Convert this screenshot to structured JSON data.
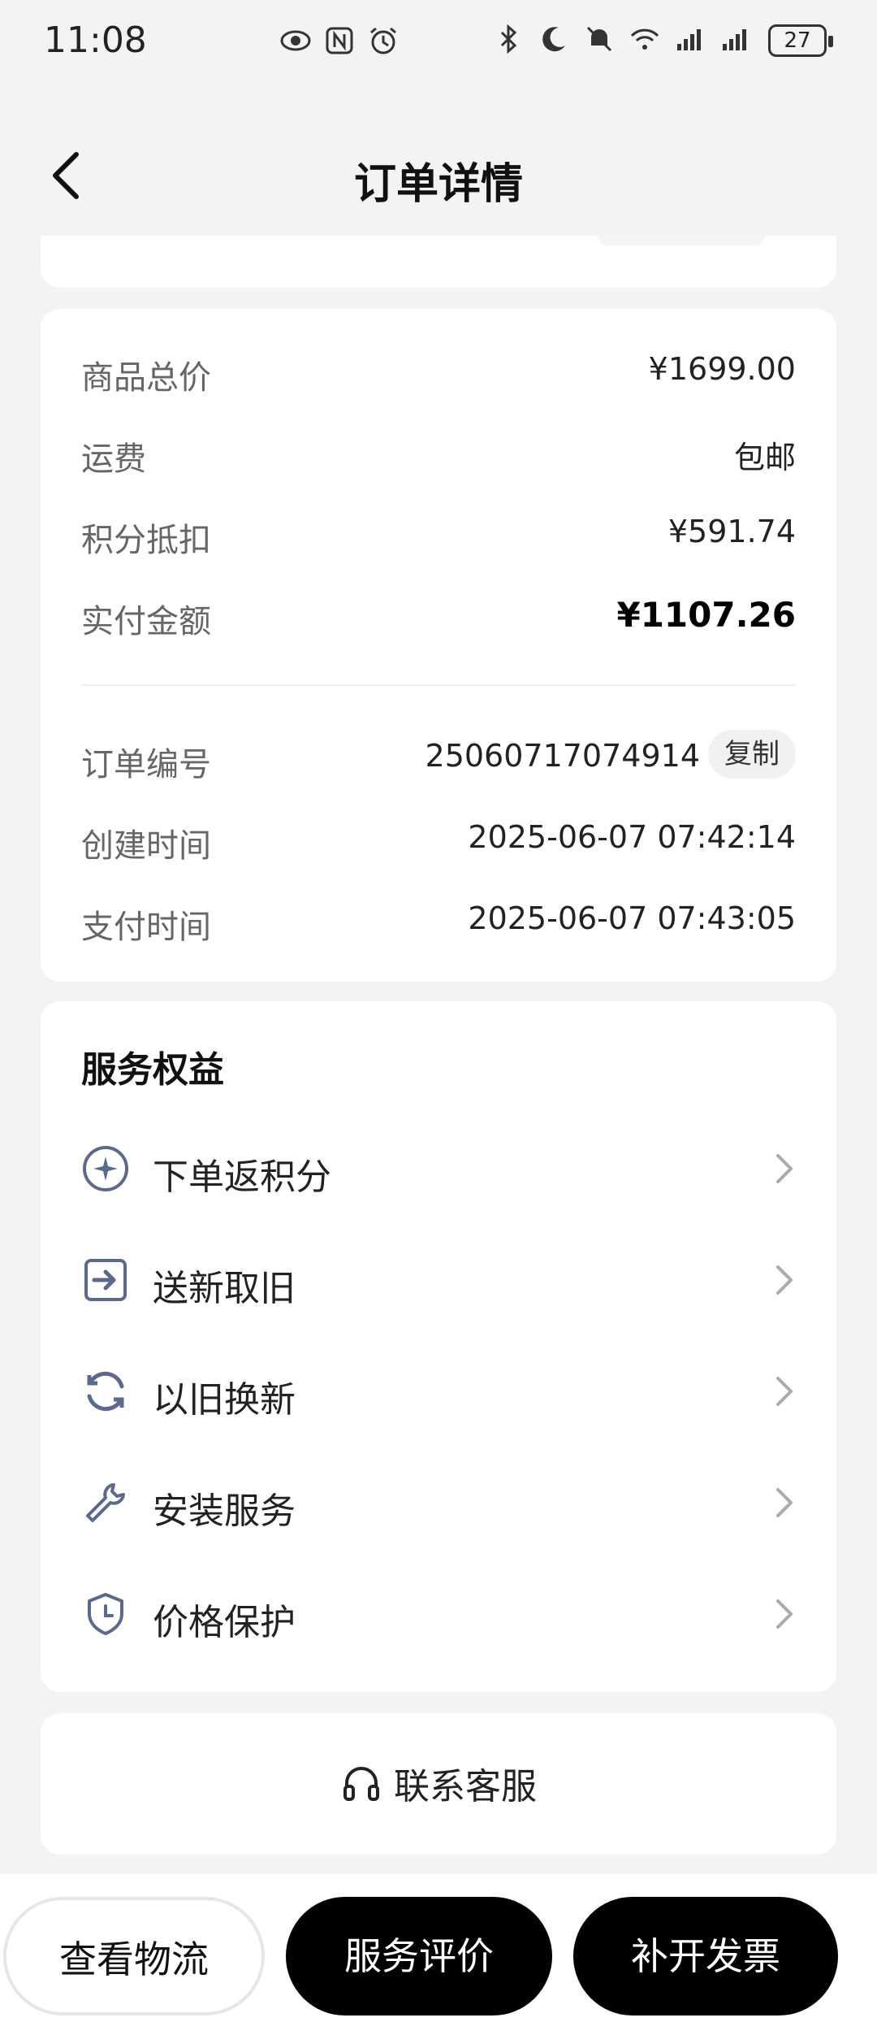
{
  "status_bar": {
    "time": "11:08",
    "battery": "27",
    "icons": [
      "eye-icon",
      "nfc-icon",
      "alarm-icon",
      "bluetooth-icon",
      "moon-icon",
      "mute-icon",
      "wifi-icon",
      "signal-icon",
      "signal-icon"
    ]
  },
  "header": {
    "title": "订单详情"
  },
  "price": {
    "rows": [
      {
        "label": "商品总价",
        "value": "¥1699.00"
      },
      {
        "label": "运费",
        "value": "包邮"
      },
      {
        "label": "积分抵扣",
        "value": "¥591.74"
      },
      {
        "label": "实付金额",
        "value": "¥1107.26"
      }
    ],
    "order": {
      "number_label": "订单编号",
      "number": "25060717074914",
      "copy_label": "复制",
      "created_label": "创建时间",
      "created": "2025-06-07 07:42:14",
      "paid_label": "支付时间",
      "paid": "2025-06-07 07:43:05"
    }
  },
  "service": {
    "title": "服务权益",
    "items": [
      {
        "label": "下单返积分",
        "icon": "star-circle-icon"
      },
      {
        "label": "送新取旧",
        "icon": "arrow-box-icon"
      },
      {
        "label": "以旧换新",
        "icon": "refresh-icon"
      },
      {
        "label": "安装服务",
        "icon": "wrench-icon"
      },
      {
        "label": "价格保护",
        "icon": "shield-clock-icon"
      }
    ]
  },
  "contact": {
    "label": "联系客服"
  },
  "actions": {
    "logistics": "查看物流",
    "review": "服务评价",
    "invoice": "补开发票"
  },
  "colors": {
    "icon_blue": "#5b6a8c",
    "accent_black": "#000000"
  }
}
